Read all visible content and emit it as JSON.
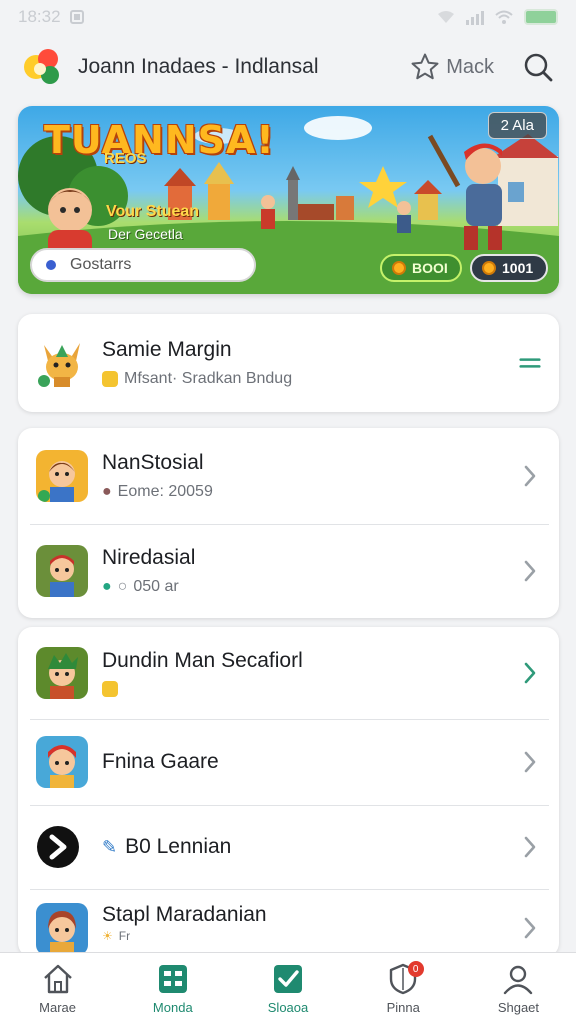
{
  "status_bar": {
    "time": "18:32"
  },
  "header": {
    "title": "Joann Inadaes - Indlansal",
    "action_label": "Mack"
  },
  "banner": {
    "title": "TUANNSA!",
    "subtitle": "REOS",
    "caption1": "Vour Stuean",
    "caption2": "Der Gecetla",
    "input_placeholder": "Gostarrs",
    "badge": "2 Ala",
    "pill_green": "BOOI",
    "pill_dark": "1001"
  },
  "featured": {
    "title": "Samie Margin",
    "subtitle": "Mfsant· Sradkan Bndug"
  },
  "list_a": [
    {
      "title": "NanStosial",
      "subtitle": "Eome: 20059"
    },
    {
      "title": "Niredasial",
      "subtitle": "050 ar"
    }
  ],
  "list_b": [
    {
      "title": "Dundin Man Secafiorl",
      "subtitle": ""
    },
    {
      "title": "Fnina Gaare",
      "subtitle": ""
    },
    {
      "title": "B0 Lennian",
      "subtitle": ""
    },
    {
      "title": "Stapl Maradanian",
      "subtitle": "Fr"
    }
  ],
  "tabs": [
    {
      "label": "Marae",
      "icon": "home-icon"
    },
    {
      "label": "Monda",
      "icon": "grid-icon"
    },
    {
      "label": "Sloaoa",
      "icon": "check-icon"
    },
    {
      "label": "Pinna",
      "icon": "shield-icon",
      "badge": "0"
    },
    {
      "label": "Shgaet",
      "icon": "profile-icon"
    }
  ],
  "colors": {
    "accent": "#1f8a70",
    "background": "#f2f3f5",
    "badge": "#e23a2e"
  }
}
